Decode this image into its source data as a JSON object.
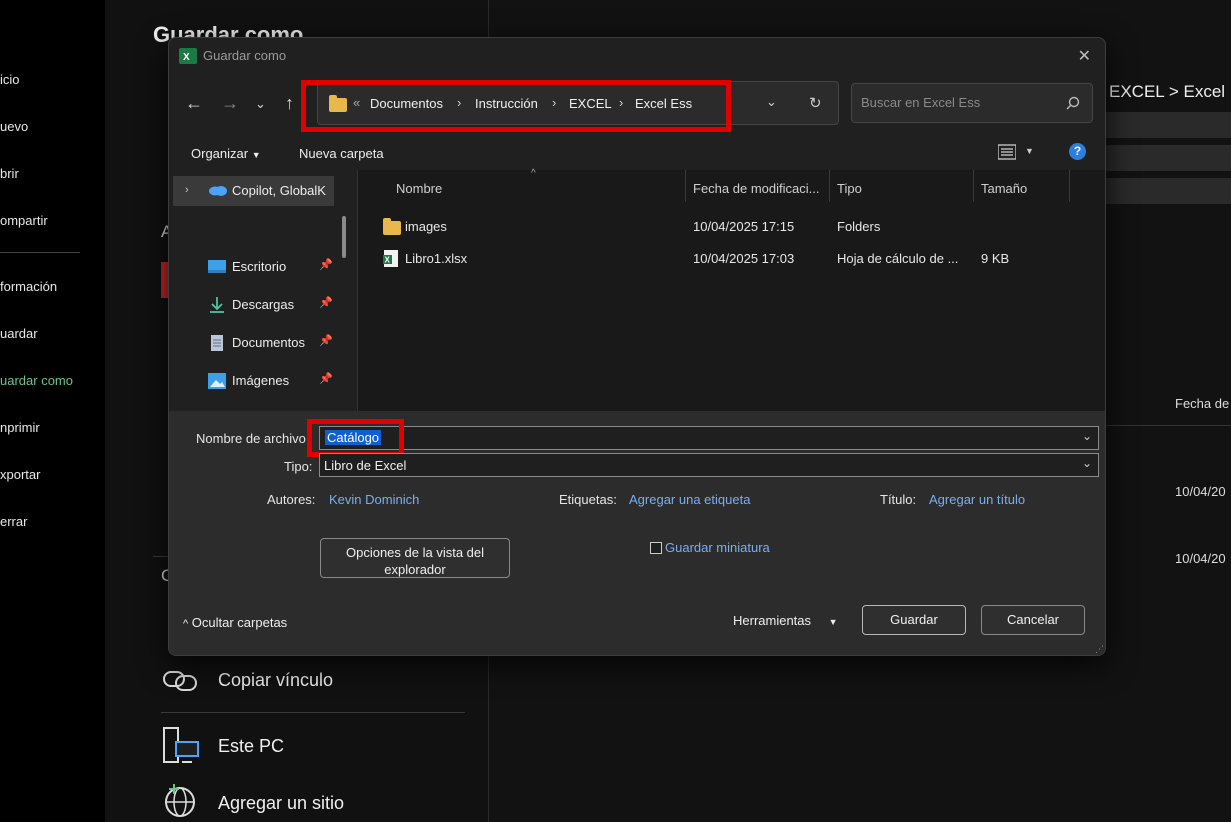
{
  "backstage": {
    "title": "Guardar como",
    "nav": [
      "icio",
      "uevo",
      "brir",
      "ompartir",
      "formación",
      "uardar",
      "uardar como",
      "nprimir",
      "xportar",
      "errar"
    ],
    "active_nav": "uardar como",
    "section_a": "A",
    "section_c": "C",
    "copy_link": "Copiar vínculo",
    "this_pc": "Este PC",
    "add_site": "Agregar un sitio",
    "breadcrumb_right": "EXCEL > Excel E",
    "fecha_header": "Fecha de",
    "dates": [
      "10/04/20",
      "10/04/20"
    ]
  },
  "dialog": {
    "title": "Guardar como",
    "address": {
      "overflow": "«",
      "crumbs": [
        "Documentos",
        "Instrucción",
        "EXCEL",
        "Excel Ess"
      ]
    },
    "search_placeholder": "Buscar en Excel Ess",
    "toolbar": {
      "organize": "Organizar",
      "new_folder": "Nueva carpeta",
      "help": "?"
    },
    "nav_pane": {
      "cloud": "Copilot, GlobalK",
      "items": [
        {
          "label": "Escritorio",
          "icon": "desktop-icon"
        },
        {
          "label": "Descargas",
          "icon": "download-icon"
        },
        {
          "label": "Documentos",
          "icon": "document-icon"
        },
        {
          "label": "Imágenes",
          "icon": "picture-icon"
        }
      ]
    },
    "columns": {
      "name": "Nombre",
      "modified": "Fecha de modificaci...",
      "type": "Tipo",
      "size": "Tamaño"
    },
    "files": [
      {
        "name": "images",
        "modified": "10/04/2025 17:15",
        "type": "Folders",
        "size": ""
      },
      {
        "name": "Libro1.xlsx",
        "modified": "10/04/2025 17:03",
        "type": "Hoja de cálculo de ...",
        "size": "9 KB"
      }
    ],
    "form": {
      "filename_label": "Nombre de archivo:",
      "filename_value": "Catálogo",
      "type_label": "Tipo:",
      "type_value": "Libro de Excel",
      "authors_label": "Autores:",
      "authors_value": "Kevin Dominich",
      "tags_label": "Etiquetas:",
      "tags_value": "Agregar una etiqueta",
      "title_label": "Título:",
      "title_value": "Agregar un título",
      "view_options_line1": "Opciones de la vista del",
      "view_options_line2": "explorador",
      "thumbnail": "Guardar miniatura",
      "hide_folders": "Ocultar carpetas",
      "tools": "Herramientas",
      "save": "Guardar",
      "cancel": "Cancelar"
    }
  },
  "colors": {
    "highlight": "#e00000",
    "link": "#7aaef0",
    "accent_nav": "#6fc38a",
    "selection": "#0f5fd0"
  }
}
